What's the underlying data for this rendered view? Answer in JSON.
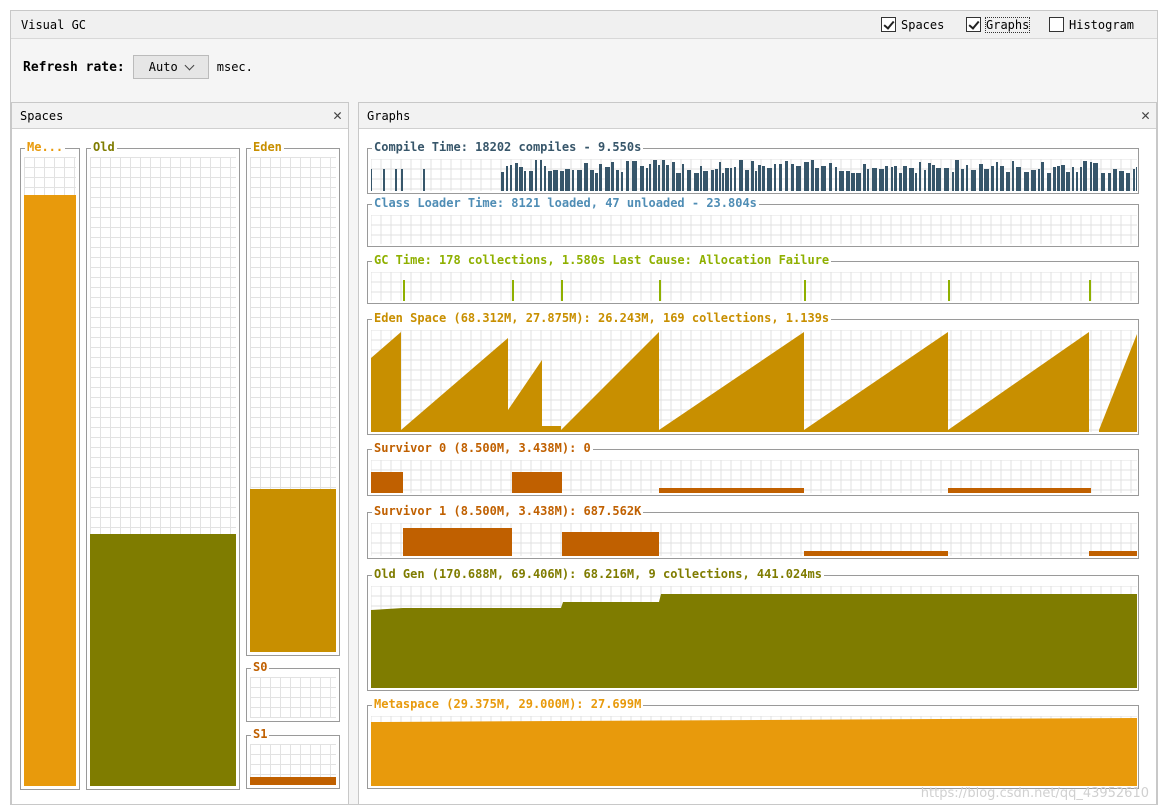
{
  "window": {
    "title": "Visual GC"
  },
  "view_options": [
    {
      "label": "Spaces",
      "checked": true
    },
    {
      "label": "Graphs",
      "checked": true
    },
    {
      "label": "Histogram",
      "checked": false
    }
  ],
  "refresh": {
    "label": "Refresh rate:",
    "value": "Auto",
    "unit": "msec."
  },
  "spaces_panel": {
    "title": "Spaces",
    "close_icon": "close-icon",
    "spaces": [
      {
        "id": "metaspace",
        "label": "Me...",
        "color": "#e89a0c",
        "label_color": "#e89a0c",
        "used_fraction": 0.94
      },
      {
        "id": "old",
        "label": "Old",
        "color": "#7f7c00",
        "label_color": "#7f7c00",
        "used_fraction": 0.4
      },
      {
        "id": "eden",
        "label": "Eden",
        "color": "#c88f00",
        "label_color": "#c88f00",
        "used_fraction": 0.33
      },
      {
        "id": "s0",
        "label": "S0",
        "color": "#c06000",
        "label_color": "#c06000",
        "used_fraction": 0.0
      },
      {
        "id": "s1",
        "label": "S1",
        "color": "#c06000",
        "label_color": "#c06000",
        "used_fraction": 0.2
      }
    ]
  },
  "graphs_panel": {
    "title": "Graphs",
    "close_icon": "close-icon",
    "graphs": [
      {
        "id": "compile",
        "label": "Compile Time: 18202 compiles - 9.550s",
        "color": "#37566a"
      },
      {
        "id": "classloader",
        "label": "Class Loader Time: 8121 loaded, 47 unloaded - 23.804s",
        "color": "#4f8db5"
      },
      {
        "id": "gc",
        "label": "GC Time: 178 collections, 1.580s  Last Cause: Allocation Failure",
        "color": "#8fb000"
      },
      {
        "id": "eden",
        "label": "Eden Space (68.312M, 27.875M): 26.243M, 169 collections, 1.139s",
        "color": "#c88f00"
      },
      {
        "id": "s0",
        "label": "Survivor 0 (8.500M, 3.438M): 0",
        "color": "#c06000"
      },
      {
        "id": "s1",
        "label": "Survivor 1 (8.500M, 3.438M): 687.562K",
        "color": "#c06000"
      },
      {
        "id": "old",
        "label": "Old Gen (170.688M, 69.406M): 68.216M, 9 collections, 441.024ms",
        "color": "#7f7c00"
      },
      {
        "id": "meta",
        "label": "Metaspace (29.375M, 29.000M): 27.699M",
        "color": "#e89a0c"
      }
    ]
  },
  "watermark": "https://blog.csdn.net/qq_43952610"
}
